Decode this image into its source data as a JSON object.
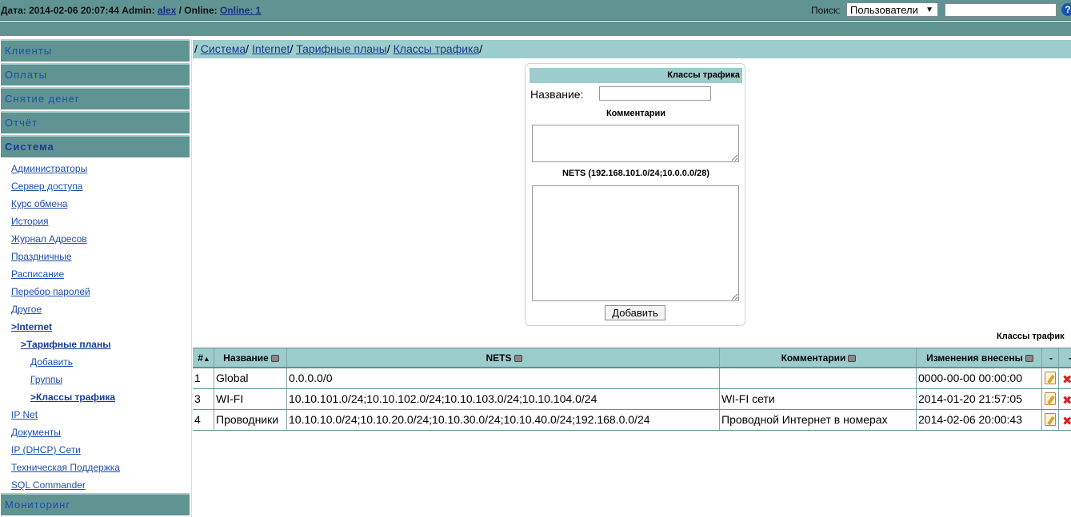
{
  "header": {
    "date_label": "Дата:",
    "date_value": "2014-02-06 20:07:44",
    "admin_label": "Admin:",
    "admin_name": "alex",
    "online_label": "/ Online:",
    "online_link": "Online: 1",
    "search_label": "Поиск:",
    "search_select_value": "Пользователи",
    "search_value": "",
    "help_glyph": "?"
  },
  "sidebar": {
    "sections": [
      {
        "label": "Клиенты"
      },
      {
        "label": "Оплаты"
      },
      {
        "label": "Снятие денег"
      },
      {
        "label": "Отчёт"
      },
      {
        "label": "Система"
      }
    ],
    "items": [
      {
        "label": "Администраторы"
      },
      {
        "label": "Сервер доступа"
      },
      {
        "label": "Курс обмена"
      },
      {
        "label": "История"
      },
      {
        "label": "Журнал Адресов"
      },
      {
        "label": "Праздничные"
      },
      {
        "label": "Расписание"
      },
      {
        "label": "Перебор паролей"
      },
      {
        "label": "Другое"
      },
      {
        "label": ">Internet"
      },
      {
        "label": ">Тарифные планы"
      },
      {
        "label": "Добавить"
      },
      {
        "label": "Группы"
      },
      {
        "label": ">Классы трафика"
      },
      {
        "label": "IP Net"
      },
      {
        "label": "Документы"
      },
      {
        "label": "IP (DHCP) Сети"
      },
      {
        "label": "Техническая Поддержка"
      },
      {
        "label": "SQL Commander"
      }
    ],
    "bottom_section": "Мониторинг"
  },
  "breadcrumb": {
    "sep": "/",
    "items": [
      "Система",
      "Internet",
      "Тарифные планы",
      "Классы трафика"
    ]
  },
  "form": {
    "title": "Классы трафика",
    "name_label": "Название:",
    "name_value": "",
    "comments_label": "Комментарии",
    "comments_value": "",
    "nets_label": "NETS (192.168.101.0/24;10.0.0.0/28)",
    "nets_value": "",
    "submit_label": "Добавить"
  },
  "table": {
    "caption": "Классы трафик",
    "columns": [
      "#",
      "Название",
      "NETS",
      "Комментарии",
      "Изменения внесены",
      "-",
      "-"
    ],
    "rows": [
      {
        "id": "1",
        "name": "Global",
        "nets": "0.0.0.0/0",
        "comment": "",
        "changed": "0000-00-00 00:00:00"
      },
      {
        "id": "3",
        "name": "WI-FI",
        "nets": "10.10.101.0/24;10.10.102.0/24;10.10.103.0/24;10.10.104.0/24",
        "comment": "WI-FI сети",
        "changed": "2014-01-20 21:57:05"
      },
      {
        "id": "4",
        "name": "Проводники",
        "nets": "10.10.10.0/24;10.10.20.0/24;10.10.30.0/24;10.10.40.0/24;192.168.0.0/24",
        "comment": "Проводной Интернет в номерах",
        "changed": "2014-02-06 20:00:43"
      }
    ]
  },
  "colors": {
    "header_bg": "#5f9492",
    "light_teal": "#9ccccb",
    "link": "#1d4fb0",
    "delete": "#dd2222"
  }
}
